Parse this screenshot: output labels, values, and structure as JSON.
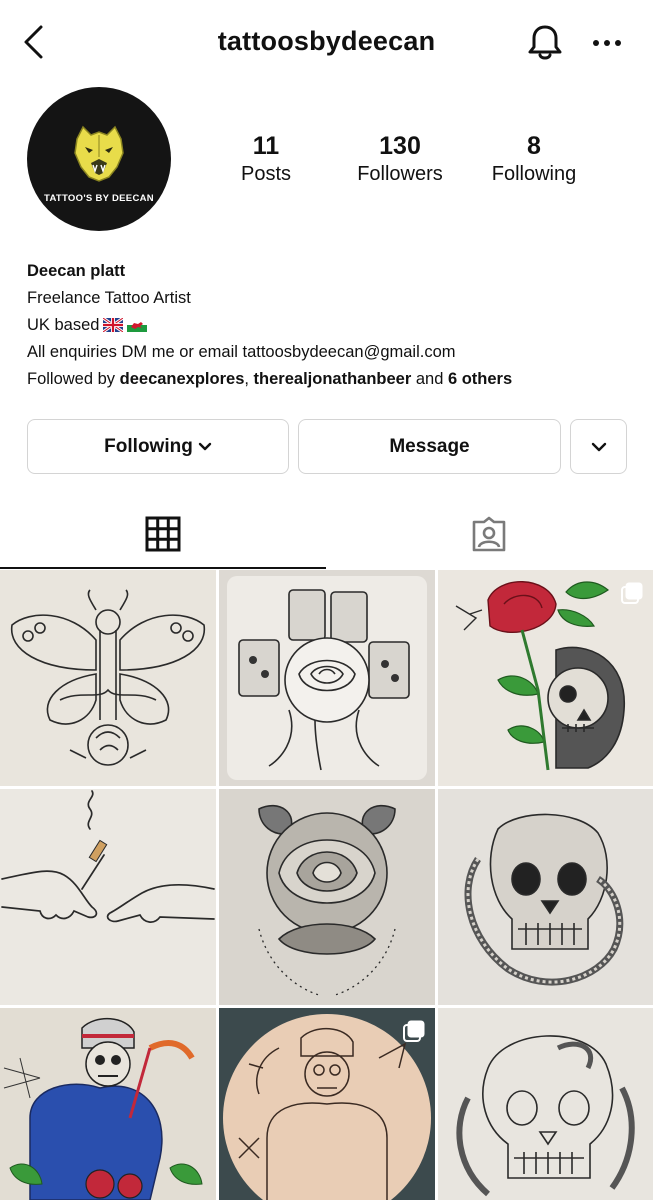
{
  "header": {
    "username": "tattoosbydeecan",
    "back_icon": "chevron-left-icon",
    "notification_icon": "bell-icon",
    "more_icon": "more-horizontal-icon"
  },
  "profile": {
    "avatar_text": "TATTOO'S BY DEECAN",
    "stats": [
      {
        "value": "11",
        "label": "Posts"
      },
      {
        "value": "130",
        "label": "Followers"
      },
      {
        "value": "8",
        "label": "Following"
      }
    ],
    "name": "Deecan platt",
    "bio_lines": [
      "Freelance Tattoo Artist",
      "UK based",
      "All enquiries DM me or email tattoosbydeecan@gmail.com"
    ],
    "followed_by": {
      "prefix": "Followed by ",
      "user1": "deecanexplores",
      "sep": ", ",
      "user2": "therealjonathanbeer",
      "middle": " and ",
      "others": "6 others"
    }
  },
  "actions": {
    "following_label": "Following",
    "message_label": "Message"
  },
  "tabs": [
    {
      "icon": "grid-icon",
      "active": true
    },
    {
      "icon": "tagged-icon",
      "active": false
    }
  ],
  "colors": {
    "text": "#111111",
    "border": "#d4d4d4",
    "avatar_bg": "#141414",
    "avatar_logo": "#e8dc4a"
  }
}
